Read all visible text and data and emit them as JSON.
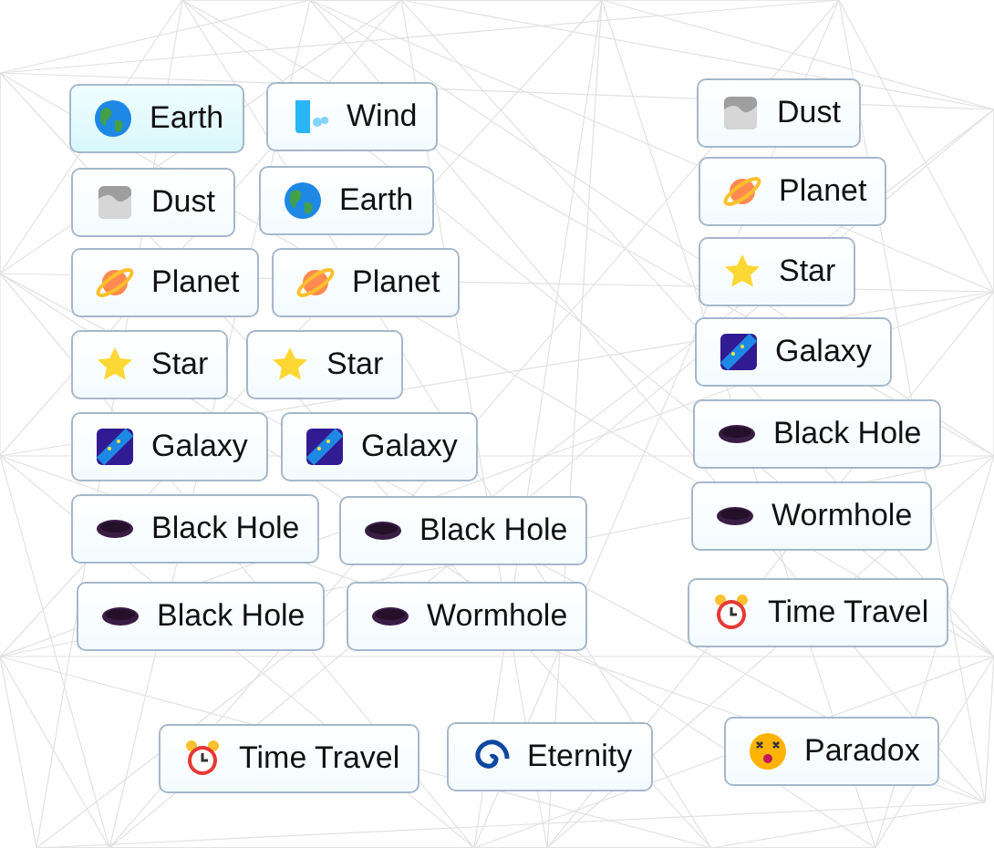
{
  "items": [
    {
      "label": "Earth",
      "kind": "earth",
      "selected": true
    },
    {
      "label": "Wind",
      "kind": "wind",
      "selected": false
    },
    {
      "label": "Dust",
      "kind": "dust",
      "selected": false
    },
    {
      "label": "Earth",
      "kind": "earth",
      "selected": false
    },
    {
      "label": "Planet",
      "kind": "planet",
      "selected": false
    },
    {
      "label": "Planet",
      "kind": "planet",
      "selected": false
    },
    {
      "label": "Star",
      "kind": "star",
      "selected": false
    },
    {
      "label": "Star",
      "kind": "star",
      "selected": false
    },
    {
      "label": "Galaxy",
      "kind": "galaxy",
      "selected": false
    },
    {
      "label": "Galaxy",
      "kind": "galaxy",
      "selected": false
    },
    {
      "label": "Black Hole",
      "kind": "hole",
      "selected": false
    },
    {
      "label": "Black Hole",
      "kind": "hole",
      "selected": false
    },
    {
      "label": "Black Hole",
      "kind": "hole",
      "selected": false
    },
    {
      "label": "Wormhole",
      "kind": "hole",
      "selected": false
    },
    {
      "label": "Time Travel",
      "kind": "clock",
      "selected": false
    },
    {
      "label": "Eternity",
      "kind": "spiral",
      "selected": false
    },
    {
      "label": "Dust",
      "kind": "dust",
      "selected": false
    },
    {
      "label": "Planet",
      "kind": "planet",
      "selected": false
    },
    {
      "label": "Star",
      "kind": "star",
      "selected": false
    },
    {
      "label": "Galaxy",
      "kind": "galaxy",
      "selected": false
    },
    {
      "label": "Black Hole",
      "kind": "hole",
      "selected": false
    },
    {
      "label": "Wormhole",
      "kind": "hole",
      "selected": false
    },
    {
      "label": "Time Travel",
      "kind": "clock",
      "selected": false
    },
    {
      "label": "Paradox",
      "kind": "dizzy",
      "selected": false
    }
  ]
}
